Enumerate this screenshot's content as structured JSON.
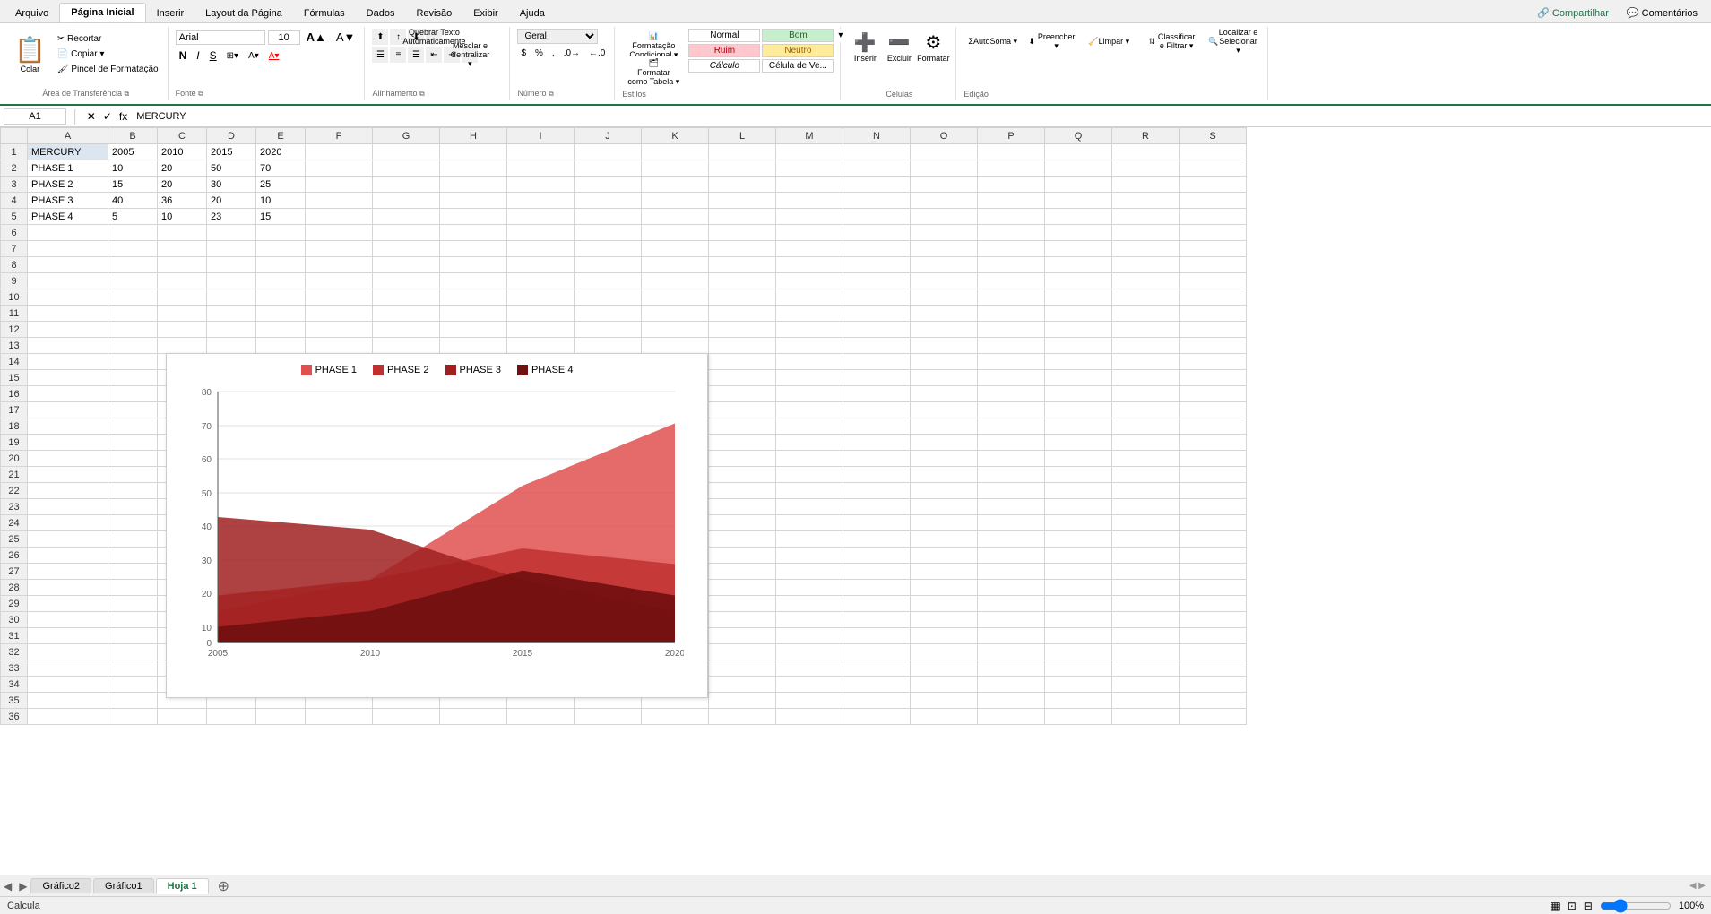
{
  "ribbon": {
    "tabs": [
      {
        "label": "Arquivo",
        "active": false
      },
      {
        "label": "Página Inicial",
        "active": true
      },
      {
        "label": "Inserir",
        "active": false
      },
      {
        "label": "Layout da Página",
        "active": false
      },
      {
        "label": "Fórmulas",
        "active": false
      },
      {
        "label": "Dados",
        "active": false
      },
      {
        "label": "Revisão",
        "active": false
      },
      {
        "label": "Exibir",
        "active": false
      },
      {
        "label": "Ajuda",
        "active": false
      }
    ],
    "top_right": [
      "Compartilhar",
      "Comentários"
    ],
    "groups": {
      "clipboard": {
        "label": "Área de Transferência",
        "buttons": [
          "Colar",
          "Recortar",
          "Copiar",
          "Pincel de Formatação"
        ]
      },
      "font": {
        "label": "Fonte",
        "font_name": "Arial",
        "font_size": "10",
        "bold": "N",
        "italic": "I",
        "underline": "S"
      },
      "alignment": {
        "label": "Alinhamento",
        "merge_label": "Mesclar e Centralizar",
        "wrap_label": "Quebrar Texto Automaticamente"
      },
      "number": {
        "label": "Número",
        "format": "Geral"
      },
      "styles": {
        "label": "Estilos",
        "conditional_format": "Formatação Condicional",
        "format_table": "Formatar como Tabela",
        "normal": "Normal",
        "bom": "Bom",
        "neutro": "Neutro",
        "ruim": "Ruim",
        "calculo": "Cálculo",
        "celula_ve": "Célula de Ve..."
      },
      "cells": {
        "label": "Células",
        "insert": "Inserir",
        "delete": "Excluir",
        "format": "Formatar"
      },
      "editing": {
        "label": "Edição",
        "autosum": "AutoSoma",
        "fill": "Preencher",
        "clear": "Limpar",
        "sort": "Classificar e Filtrar",
        "find": "Localizar e Selecionar"
      }
    }
  },
  "formula_bar": {
    "cell_ref": "A1",
    "value": "MERCURY"
  },
  "spreadsheet": {
    "columns": [
      "A",
      "B",
      "C",
      "D",
      "E",
      "F",
      "G",
      "H",
      "I",
      "J",
      "K",
      "L",
      "M",
      "N",
      "O",
      "P",
      "Q",
      "R",
      "S"
    ],
    "rows": [
      {
        "num": 1,
        "cells": [
          "MERCURY",
          "2005",
          "2010",
          "2015",
          "2020",
          "",
          "",
          "",
          "",
          "",
          "",
          "",
          "",
          "",
          "",
          "",
          "",
          "",
          ""
        ]
      },
      {
        "num": 2,
        "cells": [
          "PHASE 1",
          "10",
          "20",
          "50",
          "70",
          "",
          "",
          "",
          "",
          "",
          "",
          "",
          "",
          "",
          "",
          "",
          "",
          "",
          ""
        ]
      },
      {
        "num": 3,
        "cells": [
          "PHASE 2",
          "15",
          "20",
          "30",
          "25",
          "",
          "",
          "",
          "",
          "",
          "",
          "",
          "",
          "",
          "",
          "",
          "",
          "",
          ""
        ]
      },
      {
        "num": 4,
        "cells": [
          "PHASE 3",
          "40",
          "36",
          "20",
          "10",
          "",
          "",
          "",
          "",
          "",
          "",
          "",
          "",
          "",
          "",
          "",
          "",
          "",
          ""
        ]
      },
      {
        "num": 5,
        "cells": [
          "PHASE 4",
          "5",
          "10",
          "23",
          "15",
          "",
          "",
          "",
          "",
          "",
          "",
          "",
          "",
          "",
          "",
          "",
          "",
          "",
          ""
        ]
      },
      {
        "num": 6,
        "cells": [
          "",
          "",
          "",
          "",
          "",
          "",
          "",
          "",
          "",
          "",
          "",
          "",
          "",
          "",
          "",
          "",
          "",
          "",
          ""
        ]
      },
      {
        "num": 7,
        "cells": [
          "",
          "",
          "",
          "",
          "",
          "",
          "",
          "",
          "",
          "",
          "",
          "",
          "",
          "",
          "",
          "",
          "",
          "",
          ""
        ]
      },
      {
        "num": 8,
        "cells": [
          "",
          "",
          "",
          "",
          "",
          "",
          "",
          "",
          "",
          "",
          "",
          "",
          "",
          "",
          "",
          "",
          "",
          "",
          ""
        ]
      },
      {
        "num": 9,
        "cells": [
          "",
          "",
          "",
          "",
          "",
          "",
          "",
          "",
          "",
          "",
          "",
          "",
          "",
          "",
          "",
          "",
          "",
          "",
          ""
        ]
      },
      {
        "num": 10,
        "cells": [
          "",
          "",
          "",
          "",
          "",
          "",
          "",
          "",
          "",
          "",
          "",
          "",
          "",
          "",
          "",
          "",
          "",
          "",
          ""
        ]
      },
      {
        "num": 11,
        "cells": [
          "",
          "",
          "",
          "",
          "",
          "",
          "",
          "",
          "",
          "",
          "",
          "",
          "",
          "",
          "",
          "",
          "",
          "",
          ""
        ]
      },
      {
        "num": 12,
        "cells": [
          "",
          "",
          "",
          "",
          "",
          "",
          "",
          "",
          "",
          "",
          "",
          "",
          "",
          "",
          "",
          "",
          "",
          "",
          ""
        ]
      },
      {
        "num": 13,
        "cells": [
          "",
          "",
          "",
          "",
          "",
          "",
          "",
          "",
          "",
          "",
          "",
          "",
          "",
          "",
          "",
          "",
          "",
          "",
          ""
        ]
      },
      {
        "num": 14,
        "cells": [
          "",
          "",
          "",
          "",
          "",
          "",
          "",
          "",
          "",
          "",
          "",
          "",
          "",
          "",
          "",
          "",
          "",
          "",
          ""
        ]
      },
      {
        "num": 15,
        "cells": [
          "",
          "",
          "",
          "",
          "",
          "",
          "",
          "",
          "",
          "",
          "",
          "",
          "",
          "",
          "",
          "",
          "",
          "",
          ""
        ]
      },
      {
        "num": 16,
        "cells": [
          "",
          "",
          "",
          "",
          "",
          "",
          "",
          "",
          "",
          "",
          "",
          "",
          "",
          "",
          "",
          "",
          "",
          "",
          ""
        ]
      },
      {
        "num": 17,
        "cells": [
          "",
          "",
          "",
          "",
          "",
          "",
          "",
          "",
          "",
          "",
          "",
          "",
          "",
          "",
          "",
          "",
          "",
          "",
          ""
        ]
      },
      {
        "num": 18,
        "cells": [
          "",
          "",
          "",
          "",
          "",
          "",
          "",
          "",
          "",
          "",
          "",
          "",
          "",
          "",
          "",
          "",
          "",
          "",
          ""
        ]
      },
      {
        "num": 19,
        "cells": [
          "",
          "",
          "",
          "",
          "",
          "",
          "",
          "",
          "",
          "",
          "",
          "",
          "",
          "",
          "",
          "",
          "",
          "",
          ""
        ]
      },
      {
        "num": 20,
        "cells": [
          "",
          "",
          "",
          "",
          "",
          "",
          "",
          "",
          "",
          "",
          "",
          "",
          "",
          "",
          "",
          "",
          "",
          "",
          ""
        ]
      },
      {
        "num": 21,
        "cells": [
          "",
          "",
          "",
          "",
          "",
          "",
          "",
          "",
          "",
          "",
          "",
          "",
          "",
          "",
          "",
          "",
          "",
          "",
          ""
        ]
      },
      {
        "num": 22,
        "cells": [
          "",
          "",
          "",
          "",
          "",
          "",
          "",
          "",
          "",
          "",
          "",
          "",
          "",
          "",
          "",
          "",
          "",
          "",
          ""
        ]
      },
      {
        "num": 23,
        "cells": [
          "",
          "",
          "",
          "",
          "",
          "",
          "",
          "",
          "",
          "",
          "",
          "",
          "",
          "",
          "",
          "",
          "",
          "",
          ""
        ]
      },
      {
        "num": 24,
        "cells": [
          "",
          "",
          "",
          "",
          "",
          "",
          "",
          "",
          "",
          "",
          "",
          "",
          "",
          "",
          "",
          "",
          "",
          "",
          ""
        ]
      },
      {
        "num": 25,
        "cells": [
          "",
          "",
          "",
          "",
          "",
          "",
          "",
          "",
          "",
          "",
          "",
          "",
          "",
          "",
          "",
          "",
          "",
          "",
          ""
        ]
      },
      {
        "num": 26,
        "cells": [
          "",
          "",
          "",
          "",
          "",
          "",
          "",
          "",
          "",
          "",
          "",
          "",
          "",
          "",
          "",
          "",
          "",
          "",
          ""
        ]
      },
      {
        "num": 27,
        "cells": [
          "",
          "",
          "",
          "",
          "",
          "",
          "",
          "",
          "",
          "",
          "",
          "",
          "",
          "",
          "",
          "",
          "",
          "",
          ""
        ]
      },
      {
        "num": 28,
        "cells": [
          "",
          "",
          "",
          "",
          "",
          "",
          "",
          "",
          "",
          "",
          "",
          "",
          "",
          "",
          "",
          "",
          "",
          "",
          ""
        ]
      },
      {
        "num": 29,
        "cells": [
          "",
          "",
          "",
          "",
          "",
          "",
          "",
          "",
          "",
          "",
          "",
          "",
          "",
          "",
          "",
          "",
          "",
          "",
          ""
        ]
      },
      {
        "num": 30,
        "cells": [
          "",
          "",
          "",
          "",
          "",
          "",
          "",
          "",
          "",
          "",
          "",
          "",
          "",
          "",
          "",
          "",
          "",
          "",
          ""
        ]
      },
      {
        "num": 31,
        "cells": [
          "",
          "",
          "",
          "",
          "",
          "",
          "",
          "",
          "",
          "",
          "",
          "",
          "",
          "",
          "",
          "",
          "",
          "",
          ""
        ]
      },
      {
        "num": 32,
        "cells": [
          "",
          "",
          "",
          "",
          "",
          "",
          "",
          "",
          "",
          "",
          "",
          "",
          "",
          "",
          "",
          "",
          "",
          "",
          ""
        ]
      },
      {
        "num": 33,
        "cells": [
          "",
          "",
          "",
          "",
          "",
          "",
          "",
          "",
          "",
          "",
          "",
          "",
          "",
          "",
          "",
          "",
          "",
          "",
          ""
        ]
      },
      {
        "num": 34,
        "cells": [
          "",
          "",
          "",
          "",
          "",
          "",
          "",
          "",
          "",
          "",
          "",
          "",
          "",
          "",
          "",
          "",
          "",
          "",
          ""
        ]
      },
      {
        "num": 35,
        "cells": [
          "",
          "",
          "",
          "",
          "",
          "",
          "",
          "",
          "",
          "",
          "",
          "",
          "",
          "",
          "",
          "",
          "",
          "",
          ""
        ]
      },
      {
        "num": 36,
        "cells": [
          "",
          "",
          "",
          "",
          "",
          "",
          "",
          "",
          "",
          "",
          "",
          "",
          "",
          "",
          "",
          "",
          "",
          "",
          ""
        ]
      }
    ]
  },
  "chart": {
    "title": "",
    "legend": [
      {
        "label": "PHASE 1",
        "color": "#e05050"
      },
      {
        "label": "PHASE 2",
        "color": "#c03030"
      },
      {
        "label": "PHASE 3",
        "color": "#a02020"
      },
      {
        "label": "PHASE 4",
        "color": "#701010"
      }
    ],
    "x_labels": [
      "2005",
      "2010",
      "2015",
      "2020"
    ],
    "y_labels": [
      "0",
      "10",
      "20",
      "30",
      "40",
      "50",
      "60",
      "70",
      "80"
    ],
    "series": {
      "phase1": [
        10,
        20,
        50,
        70
      ],
      "phase2": [
        15,
        20,
        30,
        25
      ],
      "phase3": [
        40,
        36,
        20,
        10
      ],
      "phase4": [
        5,
        10,
        23,
        15
      ]
    }
  },
  "sheet_tabs": {
    "tabs": [
      "Gráfico2",
      "Gráfico1",
      "Hoja 1"
    ],
    "active": "Hoja 1"
  },
  "status_bar": {
    "text": "Calcula"
  }
}
